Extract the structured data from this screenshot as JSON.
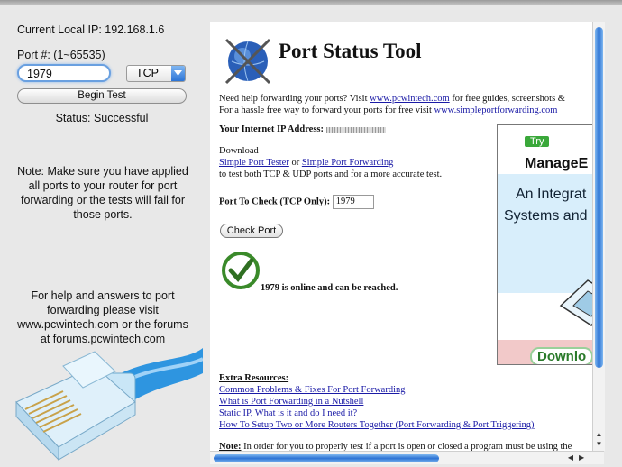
{
  "left": {
    "ip_label": "Current Local IP: 192.168.1.6",
    "port_label": "Port #: (1~65535)",
    "port_value": "1979",
    "protocol_value": "TCP",
    "begin_button": "Begin Test",
    "status": "Status: Successful",
    "note": "Note: Make sure you have applied all ports to your router for port forwarding or the tests will fail for those ports.",
    "help": "For help and answers to port forwarding please visit www.pcwintech.com or the forums at forums.pcwintech.com"
  },
  "web": {
    "title": "Port Status Tool",
    "intro1_a": "Need help forwarding your ports? Visit ",
    "intro1_link": "www.pcwintech.com",
    "intro1_b": " for free guides, screenshots &",
    "intro2_a": "For a hassle free way to forward your ports for free visit ",
    "intro2_link": "www.simpleportforwarding.com",
    "ip_label": "Your Internet IP Address:",
    "download": "Download",
    "link_tester": "Simple Port Tester",
    "or": " or ",
    "link_forwarding": "Simple Port Forwarding",
    "download_tail": "to test both TCP & UDP ports and for a more accurate test.",
    "port_check_label": "Port To Check (TCP Only):",
    "port_check_value": "1979",
    "check_button": "Check Port",
    "result": "1979 is online and can be reached.",
    "extra_title": "Extra Resources:",
    "resources": [
      "Common Problems & Fixes For Port Forwarding",
      "What is Port Forwarding in a Nutshell",
      "Static IP, What is it and do I need it?",
      "How To Setup Two or More Routers Together (Port Forwarding & Port Triggering)"
    ],
    "note_label": "Note:",
    "note_text": " In order for you to properly test if a port is open or closed a program must be using the"
  },
  "ad": {
    "try": "Try",
    "line1": "ManageE",
    "line2": "An Integrat",
    "line3": "Systems and",
    "download": "Downlo"
  },
  "colors": {
    "link": "#1a1aa6",
    "accent": "#2c72d4",
    "check": "#3a8a2a"
  }
}
